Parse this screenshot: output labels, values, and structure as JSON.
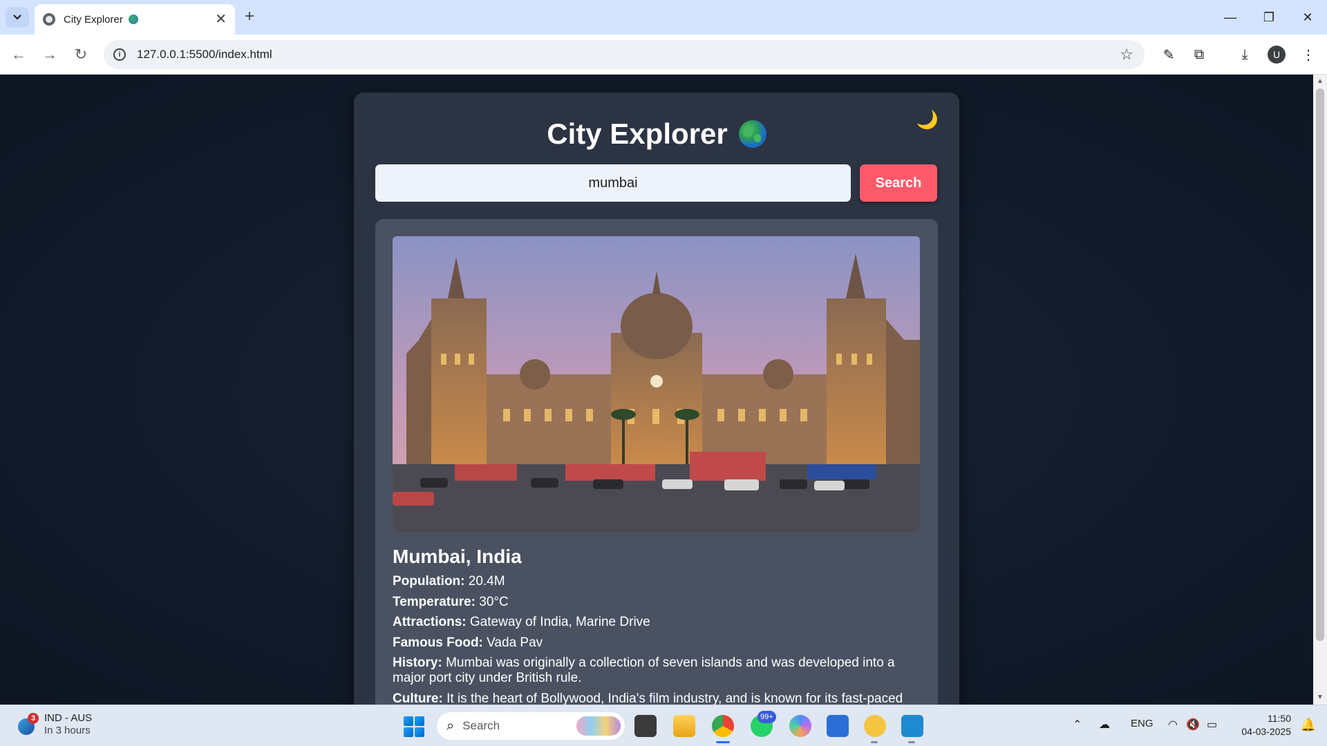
{
  "browser": {
    "tab_title": "City Explorer",
    "url": "127.0.0.1:5500/index.html",
    "profile_initial": "U"
  },
  "app": {
    "title": "City Explorer",
    "search_value": "mumbai",
    "search_button": "Search",
    "theme_icon": "moon-icon"
  },
  "city": {
    "name": "Mumbai, India",
    "facts": [
      {
        "label": "Population:",
        "value": " 20.4M"
      },
      {
        "label": "Temperature:",
        "value": " 30°C"
      },
      {
        "label": "Attractions:",
        "value": " Gateway of India, Marine Drive"
      },
      {
        "label": "Famous Food:",
        "value": " Vada Pav"
      },
      {
        "label": "History:",
        "value": " Mumbai was originally a collection of seven islands and was developed into a major port city under British rule."
      },
      {
        "label": "Culture:",
        "value": " It is the heart of Bollywood, India's film industry, and is known for its fast-paced"
      }
    ]
  },
  "taskbar": {
    "weather_title": "IND - AUS",
    "weather_sub": "In 3 hours",
    "weather_badge": "3",
    "search_label": "Search",
    "whatsapp_badge": "99+",
    "lang": "ENG",
    "time": "11:50",
    "date": "04-03-2025"
  },
  "colors": {
    "accent": "#ff5a6a",
    "card": "#2c3444",
    "result_card": "#4a5262"
  }
}
